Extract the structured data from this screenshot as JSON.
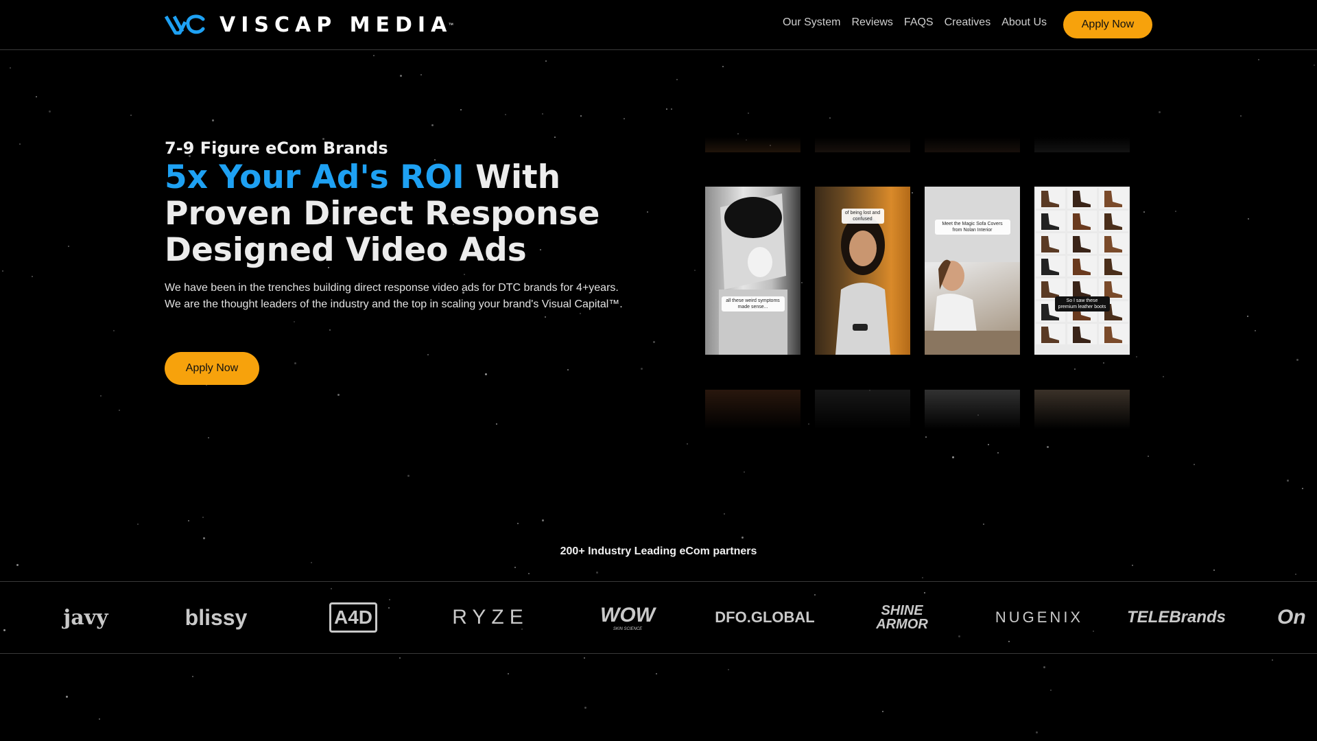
{
  "brand": {
    "name": "VISCAP MEDIA",
    "tm": "™",
    "accent_color": "#1ea1f3",
    "cta_color": "#f7a20c"
  },
  "nav": {
    "links": [
      "Our System",
      "Reviews",
      "FAQS",
      "Creatives",
      "About Us"
    ],
    "apply_label": "Apply Now"
  },
  "hero": {
    "eyebrow": "7-9 Figure eCom Brands",
    "headline_accent": "5x Your Ad's ROI",
    "headline_rest_1": " With",
    "headline_rest_2": "Proven Direct Response",
    "headline_rest_3": "Designed Video Ads",
    "subcopy": "We have been in the trenches building direct response video ads for DTC brands for 4+years. We are the thought leaders of the industry and the top in scaling your brand's Visual Capital™.",
    "apply_label": "Apply Now"
  },
  "videos": {
    "captions": [
      "all these weird symptoms made sense...",
      "of being lost and confused",
      "Meet the Magic Sofa Covers from Nolan Interior",
      "So I saw these premium leather boots"
    ]
  },
  "partners": {
    "title": "200+ Industry Leading eCom partners",
    "logos": [
      "javy",
      "blissy",
      "A4D",
      "RYZE",
      "WOW",
      "DFO.GLOBAL",
      "SHINE ARMOR",
      "NUGENIX",
      "TELEBrands",
      "On"
    ],
    "logo_sublabels": {
      "wow": "SKIN SCIENCE"
    }
  }
}
